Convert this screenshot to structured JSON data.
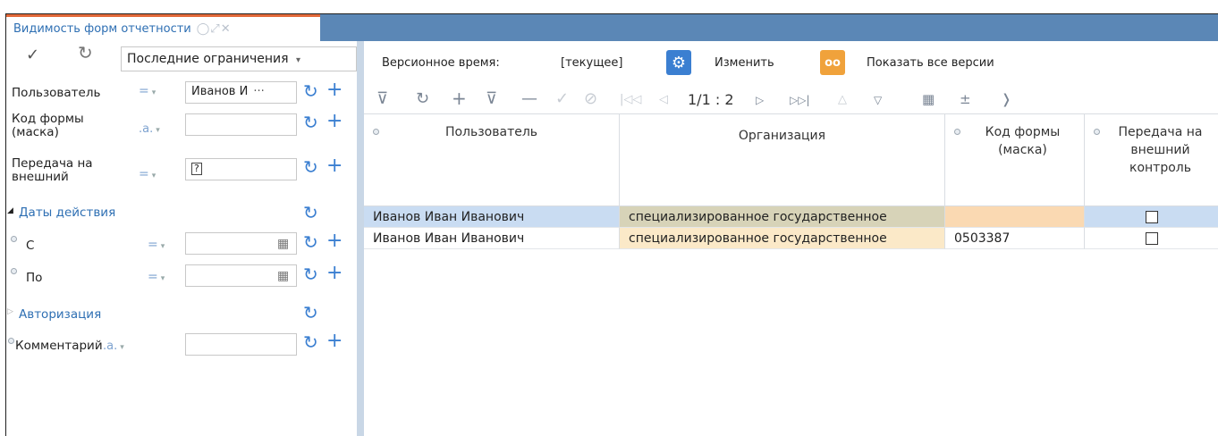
{
  "tab": {
    "title": "Видимость форм отчетности",
    "icons": "◯⤢✕"
  },
  "filter": {
    "apply_icon": "✓",
    "refresh_icon": "↻",
    "preset": "Последние ограничения",
    "fields": [
      {
        "label": "Пользователь",
        "op": "=",
        "value": "Иванов И"
      },
      {
        "label": "Код формы (маска)",
        "op": ".a.",
        "value": ""
      },
      {
        "label": "Передача на внешний",
        "op": "=",
        "value": "?"
      }
    ],
    "dates_section": "Даты действия",
    "date_from": "С",
    "date_to": "По",
    "auth_section": "Авторизация",
    "comment_label": "Комментарий",
    "comment_op": ".a."
  },
  "top": {
    "version_label": "Версионное время:",
    "version_value": "[текущее]",
    "change": "Изменить",
    "show_all": "Показать все версии"
  },
  "pager": "1/1 : 2",
  "columns": [
    "Пользователь",
    "Организация",
    "Код формы (маска)",
    "Передача на внешний контроль"
  ],
  "rows": [
    {
      "user": "Иванов Иван Иванович",
      "org": "специализированное государственное",
      "code": "",
      "external": false
    },
    {
      "user": "Иванов Иван Иванович",
      "org": "специализированное государственное",
      "code": "0503387",
      "external": false
    }
  ],
  "colors": {
    "accent": "#3b7fd1",
    "header": "#5b87b6",
    "tab_top": "#e36a3b",
    "selected_row": "#c9dcf2",
    "org_cell": "#fbe9c8",
    "org_cell_sel": "#d7d3b8",
    "code_cell_sel": "#fad9b2"
  }
}
